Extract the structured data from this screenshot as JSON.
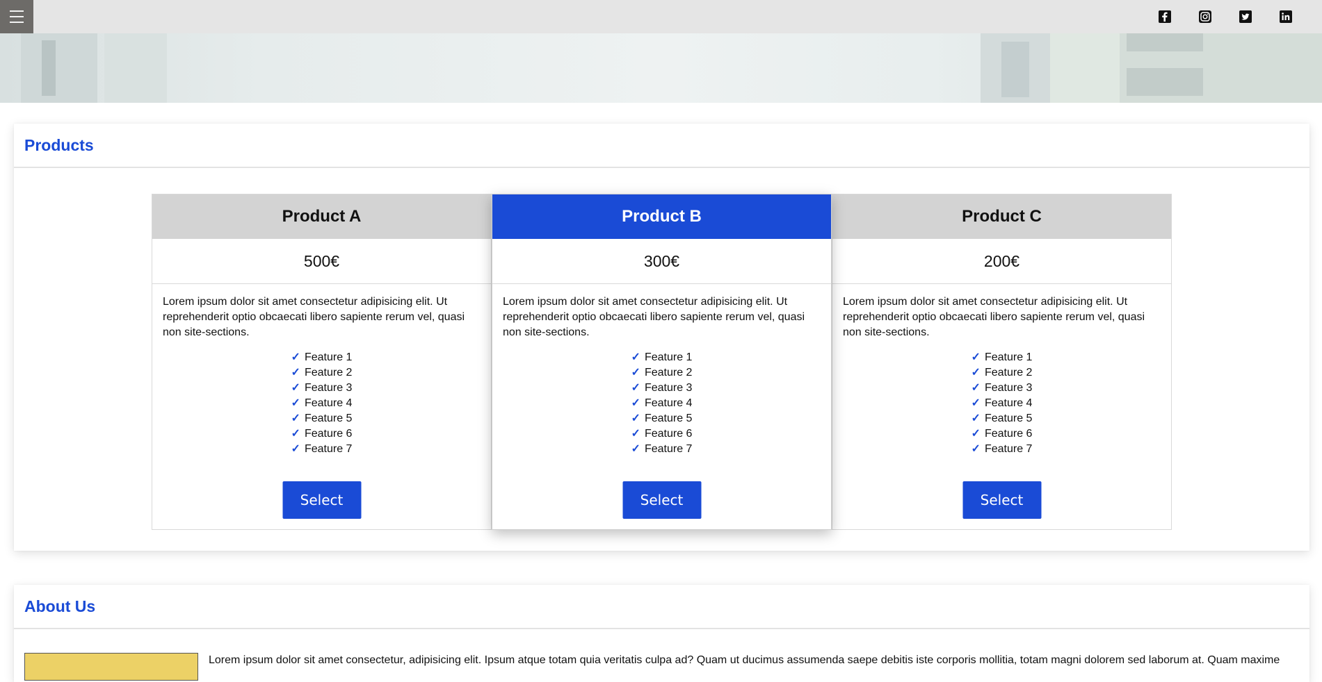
{
  "topbar": {
    "menu_icon": "hamburger-menu-icon",
    "social": [
      {
        "name": "facebook",
        "icon": "facebook-icon"
      },
      {
        "name": "instagram",
        "icon": "instagram-icon"
      },
      {
        "name": "twitter",
        "icon": "twitter-icon"
      },
      {
        "name": "linkedin",
        "icon": "linkedin-icon"
      }
    ]
  },
  "colors": {
    "accent": "#1a4bd6",
    "topbar_bg": "#e5e5e5",
    "menu_bg": "#6d6b68",
    "plan_header_bg": "#d3d3d3",
    "about_image": "#ecd166"
  },
  "products": {
    "title": "Products",
    "plans": [
      {
        "name": "Product A",
        "price": "500€",
        "description": "Lorem ipsum dolor sit amet consectetur adipisicing elit. Ut reprehenderit optio obcaecati libero sapiente rerum vel, quasi non site-sections.",
        "features": [
          "Feature 1",
          "Feature 2",
          "Feature 3",
          "Feature 4",
          "Feature 5",
          "Feature 6",
          "Feature 7"
        ],
        "button": "Select",
        "featured": false
      },
      {
        "name": "Product B",
        "price": "300€",
        "description": "Lorem ipsum dolor sit amet consectetur adipisicing elit. Ut reprehenderit optio obcaecati libero sapiente rerum vel, quasi non site-sections.",
        "features": [
          "Feature 1",
          "Feature 2",
          "Feature 3",
          "Feature 4",
          "Feature 5",
          "Feature 6",
          "Feature 7"
        ],
        "button": "Select",
        "featured": true
      },
      {
        "name": "Product C",
        "price": "200€",
        "description": "Lorem ipsum dolor sit amet consectetur adipisicing elit. Ut reprehenderit optio obcaecati libero sapiente rerum vel, quasi non site-sections.",
        "features": [
          "Feature 1",
          "Feature 2",
          "Feature 3",
          "Feature 4",
          "Feature 5",
          "Feature 6",
          "Feature 7"
        ],
        "button": "Select",
        "featured": false
      }
    ]
  },
  "about": {
    "title": "About Us",
    "text": "Lorem ipsum dolor sit amet consectetur, adipisicing elit. Ipsum atque totam quia veritatis culpa ad? Quam ut ducimus assumenda saepe debitis iste corporis mollitia, totam magni dolorem sed laborum at. Quam maxime"
  }
}
